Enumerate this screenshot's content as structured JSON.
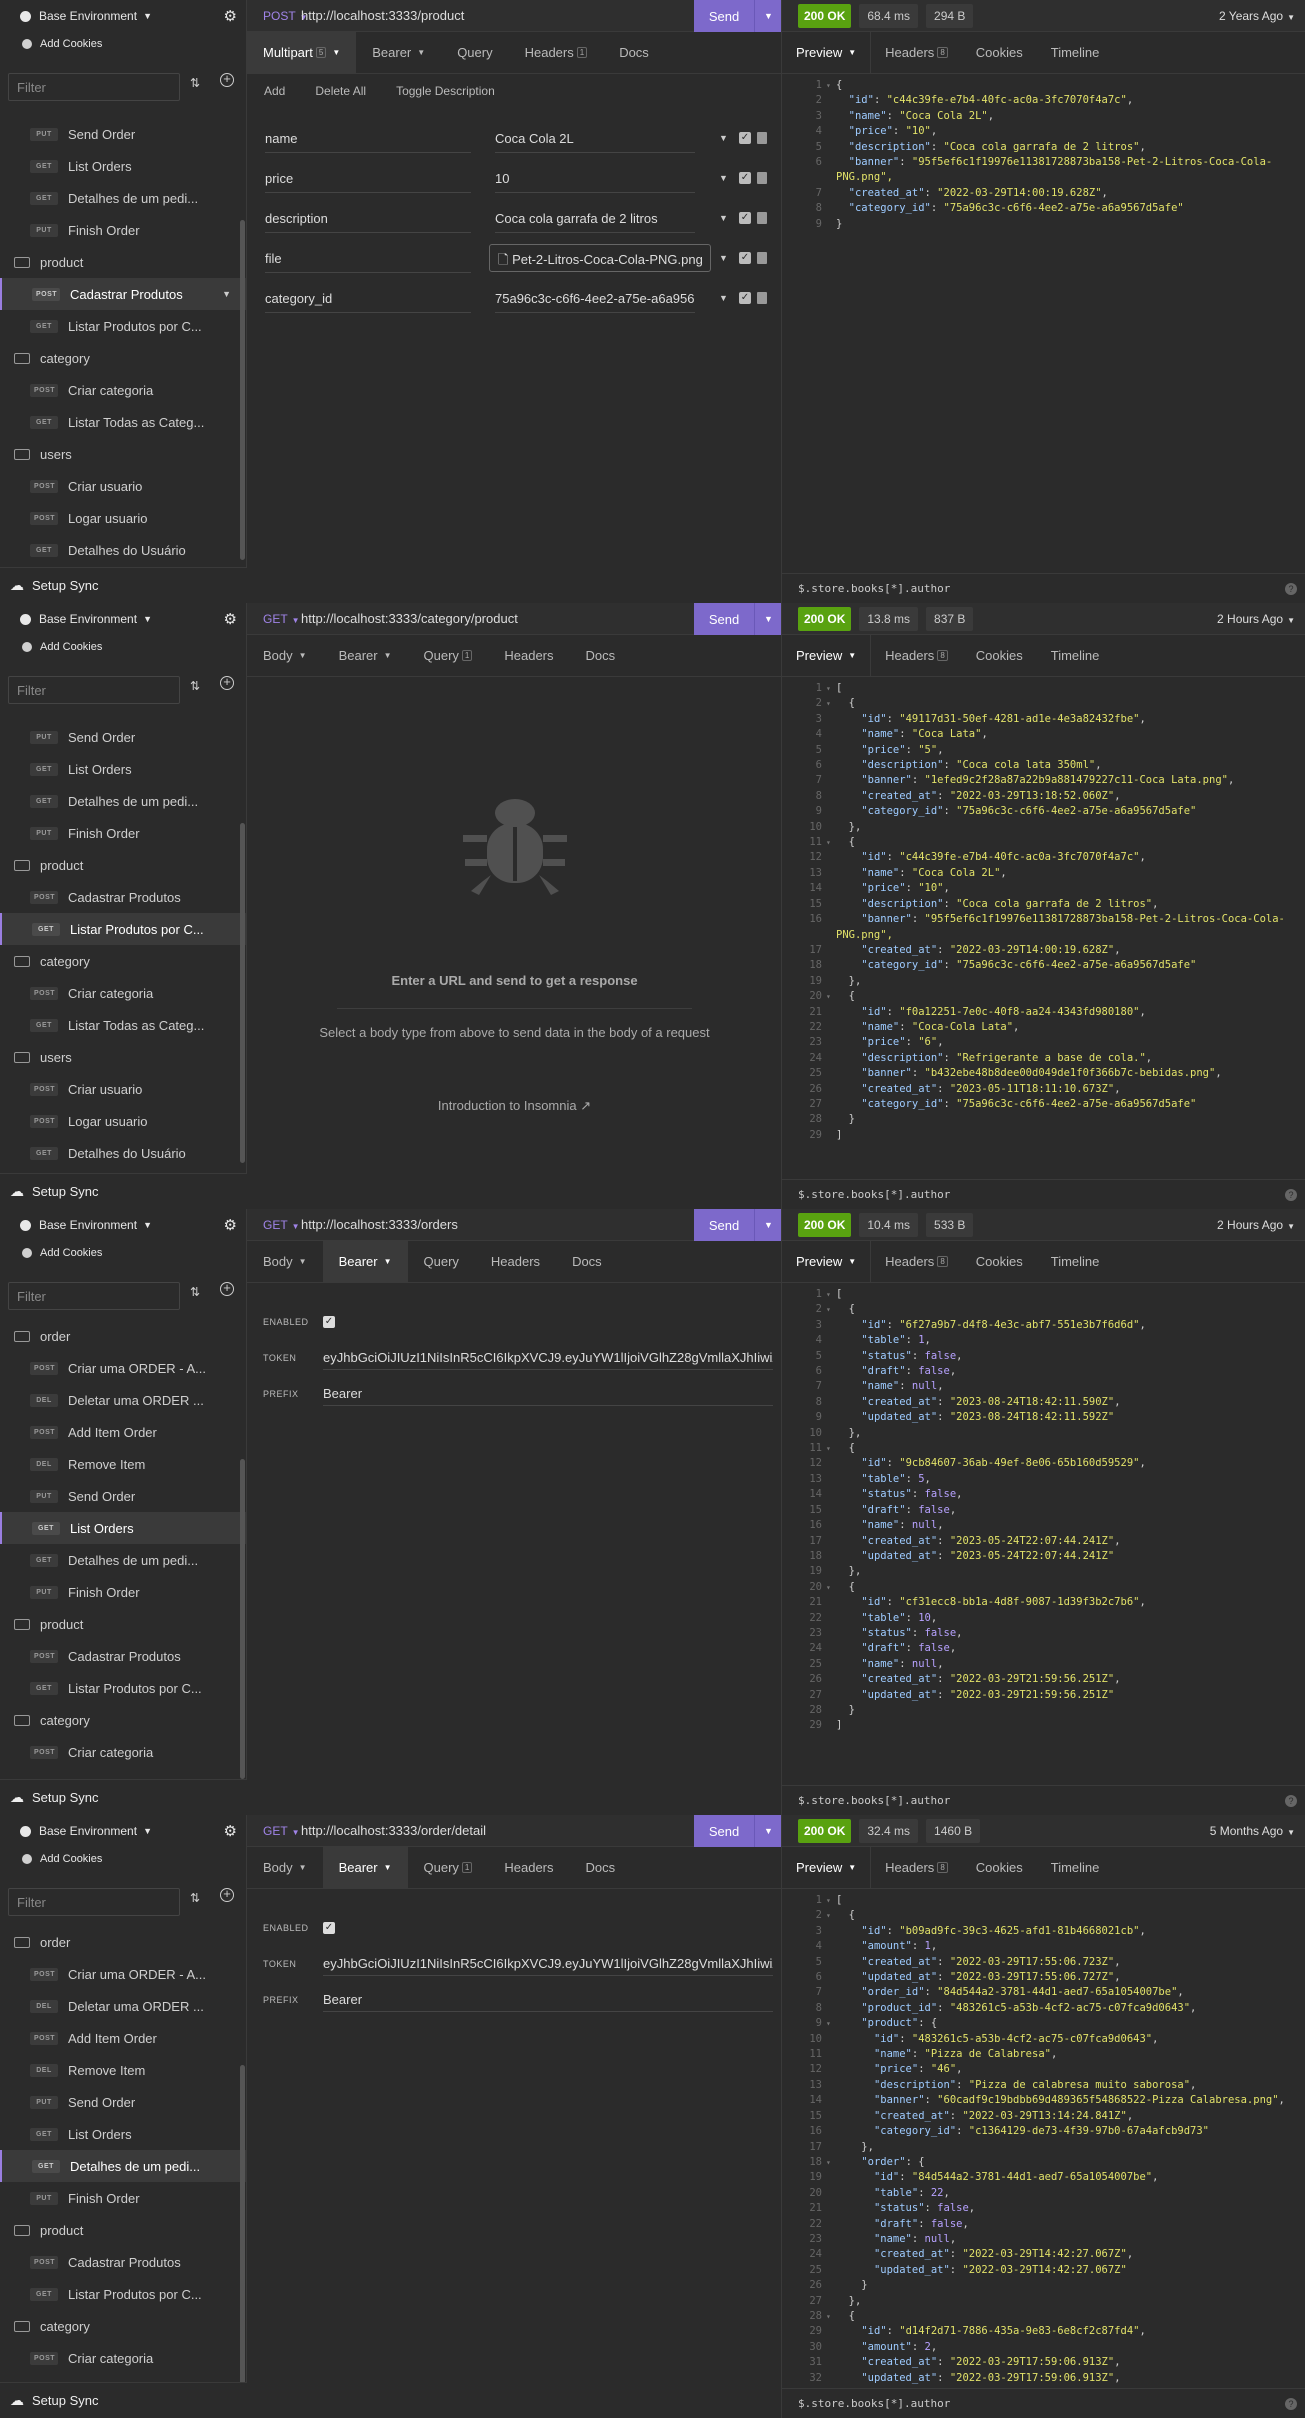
{
  "env": {
    "label": "Base Environment",
    "cookies": "Add Cookies",
    "filter_placeholder": "Filter",
    "sync": "Setup Sync"
  },
  "panels": [
    {
      "sidebar": [
        {
          "t": "item",
          "badge": "PUT",
          "label": "Send Order"
        },
        {
          "t": "item",
          "badge": "GET",
          "label": "List Orders"
        },
        {
          "t": "item",
          "badge": "GET",
          "label": "Detalhes de um pedi..."
        },
        {
          "t": "item",
          "badge": "PUT",
          "label": "Finish Order"
        },
        {
          "t": "folder",
          "label": "product"
        },
        {
          "t": "item",
          "badge": "POST",
          "label": "Cadastrar Produtos",
          "sel": true
        },
        {
          "t": "item",
          "badge": "GET",
          "label": "Listar Produtos por C..."
        },
        {
          "t": "folder",
          "label": "category"
        },
        {
          "t": "item",
          "badge": "POST",
          "label": "Criar categoria"
        },
        {
          "t": "item",
          "badge": "GET",
          "label": "Listar Todas as Categ..."
        },
        {
          "t": "folder",
          "label": "users"
        },
        {
          "t": "item",
          "badge": "POST",
          "label": "Criar usuario"
        },
        {
          "t": "item",
          "badge": "POST",
          "label": "Logar usuario"
        },
        {
          "t": "item",
          "badge": "GET",
          "label": "Detalhes do Usuário"
        }
      ],
      "method": "POST",
      "url": "http://localhost:3333/product",
      "send": "Send",
      "tabs": [
        {
          "label": "Multipart",
          "count": "5",
          "active": true,
          "caret": true
        },
        {
          "label": "Bearer",
          "caret": true
        },
        {
          "label": "Query"
        },
        {
          "label": "Headers",
          "count": "1"
        },
        {
          "label": "Docs"
        }
      ],
      "subbar": [
        "Add",
        "Delete All",
        "Toggle Description"
      ],
      "fields": [
        {
          "k": "name",
          "v": "Coca Cola 2L"
        },
        {
          "k": "price",
          "v": "10"
        },
        {
          "k": "description",
          "v": "Coca cola garrafa de 2 litros"
        },
        {
          "k": "file",
          "v": "Pet-2-Litros-Coca-Cola-PNG.png",
          "file": true
        },
        {
          "k": "category_id",
          "v": "75a96c3c-c6f6-4ee2-a75e-a6a9567"
        }
      ],
      "status": "200 OK",
      "time": "68.4 ms",
      "size": "294 B",
      "ago": "2 Years Ago",
      "rtabs": [
        {
          "label": "Preview",
          "active": true,
          "caret": true
        },
        {
          "label": "Headers",
          "count": "8"
        },
        {
          "label": "Cookies"
        },
        {
          "label": "Timeline"
        }
      ],
      "code": [
        "{",
        "  \"id\": \"c44c39fe-e7b4-40fc-ac0a-3fc7070f4a7c\",",
        "  \"name\": \"Coca Cola 2L\",",
        "  \"price\": \"10\",",
        "  \"description\": \"Coca cola garrafa de 2 litros\",",
        "  \"banner\": \"95f5ef6c1f19976e11381728873ba158-Pet-2-Litros-Coca-Cola-|PNG.png\",",
        "  \"created_at\": \"2022-03-29T14:00:19.628Z\",",
        "  \"category_id\": \"75a96c3c-c6f6-4ee2-a75e-a6a9567d5afe\"",
        "}"
      ],
      "query": "$.store.books[*].author"
    },
    {
      "sidebar": [
        {
          "t": "item",
          "badge": "PUT",
          "label": "Send Order"
        },
        {
          "t": "item",
          "badge": "GET",
          "label": "List Orders"
        },
        {
          "t": "item",
          "badge": "GET",
          "label": "Detalhes de um pedi..."
        },
        {
          "t": "item",
          "badge": "PUT",
          "label": "Finish Order"
        },
        {
          "t": "folder",
          "label": "product"
        },
        {
          "t": "item",
          "badge": "POST",
          "label": "Cadastrar Produtos"
        },
        {
          "t": "item",
          "badge": "GET",
          "label": "Listar Produtos por C...",
          "sel": true
        },
        {
          "t": "folder",
          "label": "category"
        },
        {
          "t": "item",
          "badge": "POST",
          "label": "Criar categoria"
        },
        {
          "t": "item",
          "badge": "GET",
          "label": "Listar Todas as Categ..."
        },
        {
          "t": "folder",
          "label": "users"
        },
        {
          "t": "item",
          "badge": "POST",
          "label": "Criar usuario"
        },
        {
          "t": "item",
          "badge": "POST",
          "label": "Logar usuario"
        },
        {
          "t": "item",
          "badge": "GET",
          "label": "Detalhes do Usuário"
        }
      ],
      "method": "GET",
      "url": "http://localhost:3333/category/product",
      "send": "Send",
      "tabs": [
        {
          "label": "Body",
          "caret": true
        },
        {
          "label": "Bearer",
          "caret": true
        },
        {
          "label": "Query",
          "count": "1"
        },
        {
          "label": "Headers"
        },
        {
          "label": "Docs"
        }
      ],
      "empty": {
        "title": "Enter a URL and send to get a response",
        "sub": "Select a body type from above to send data in the body of a request",
        "link": "Introduction to Insomnia"
      },
      "status": "200 OK",
      "time": "13.8 ms",
      "size": "837 B",
      "ago": "2 Hours Ago",
      "rtabs": [
        {
          "label": "Preview",
          "active": true,
          "caret": true
        },
        {
          "label": "Headers",
          "count": "8"
        },
        {
          "label": "Cookies"
        },
        {
          "label": "Timeline"
        }
      ],
      "code": [
        "[",
        "  {",
        "    \"id\": \"49117d31-50ef-4281-ad1e-4e3a82432fbe\",",
        "    \"name\": \"Coca Lata\",",
        "    \"price\": \"5\",",
        "    \"description\": \"Coca cola lata 350ml\",",
        "    \"banner\": \"1efed9c2f28a87a22b9a881479227c11-Coca Lata.png\",",
        "    \"created_at\": \"2022-03-29T13:18:52.060Z\",",
        "    \"category_id\": \"75a96c3c-c6f6-4ee2-a75e-a6a9567d5afe\"",
        "  },",
        "  {",
        "    \"id\": \"c44c39fe-e7b4-40fc-ac0a-3fc7070f4a7c\",",
        "    \"name\": \"Coca Cola 2L\",",
        "    \"price\": \"10\",",
        "    \"description\": \"Coca cola garrafa de 2 litros\",",
        "    \"banner\": \"95f5ef6c1f19976e11381728873ba158-Pet-2-Litros-Coca-Cola-|PNG.png\",",
        "    \"created_at\": \"2022-03-29T14:00:19.628Z\",",
        "    \"category_id\": \"75a96c3c-c6f6-4ee2-a75e-a6a9567d5afe\"",
        "  },",
        "  {",
        "    \"id\": \"f0a12251-7e0c-40f8-aa24-4343fd980180\",",
        "    \"name\": \"Coca-Cola Lata\",",
        "    \"price\": \"6\",",
        "    \"description\": \"Refrigerante a base de cola.\",",
        "    \"banner\": \"b432ebe48b8dee00d049de1f0f366b7c-bebidas.png\",",
        "    \"created_at\": \"2023-05-11T18:11:10.673Z\",",
        "    \"category_id\": \"75a96c3c-c6f6-4ee2-a75e-a6a9567d5afe\"",
        "  }",
        "]"
      ],
      "query": "$.store.books[*].author"
    },
    {
      "sidebar": [
        {
          "t": "folder",
          "label": "order"
        },
        {
          "t": "item",
          "badge": "POST",
          "label": "Criar uma ORDER - A..."
        },
        {
          "t": "item",
          "badge": "DEL",
          "label": "Deletar uma ORDER ..."
        },
        {
          "t": "item",
          "badge": "POST",
          "label": "Add Item Order"
        },
        {
          "t": "item",
          "badge": "DEL",
          "label": "Remove Item"
        },
        {
          "t": "item",
          "badge": "PUT",
          "label": "Send Order"
        },
        {
          "t": "item",
          "badge": "GET",
          "label": "List Orders",
          "sel": true
        },
        {
          "t": "item",
          "badge": "GET",
          "label": "Detalhes de um pedi..."
        },
        {
          "t": "item",
          "badge": "PUT",
          "label": "Finish Order"
        },
        {
          "t": "folder",
          "label": "product"
        },
        {
          "t": "item",
          "badge": "POST",
          "label": "Cadastrar Produtos"
        },
        {
          "t": "item",
          "badge": "GET",
          "label": "Listar Produtos por C..."
        },
        {
          "t": "folder",
          "label": "category"
        },
        {
          "t": "item",
          "badge": "POST",
          "label": "Criar categoria"
        }
      ],
      "method": "GET",
      "url": "http://localhost:3333/orders",
      "send": "Send",
      "tabs": [
        {
          "label": "Body",
          "caret": true
        },
        {
          "label": "Bearer",
          "caret": true,
          "active": true
        },
        {
          "label": "Query"
        },
        {
          "label": "Headers"
        },
        {
          "label": "Docs"
        }
      ],
      "auth": {
        "enabled": "ENABLED",
        "token_label": "TOKEN",
        "token": "eyJhbGciOiJIUzI1NiIsInR5cCI6IkpXVCJ9.eyJuYW1lIjoiVGlhZ28gVmllaXJhIiwiZW",
        "prefix_label": "PREFIX",
        "prefix": "Bearer"
      },
      "status": "200 OK",
      "time": "10.4 ms",
      "size": "533 B",
      "ago": "2 Hours Ago",
      "rtabs": [
        {
          "label": "Preview",
          "active": true,
          "caret": true
        },
        {
          "label": "Headers",
          "count": "8"
        },
        {
          "label": "Cookies"
        },
        {
          "label": "Timeline"
        }
      ],
      "code": [
        "[",
        "  {",
        "    \"id\": \"6f27a9b7-d4f8-4e3c-abf7-551e3b7f6d6d\",",
        "    \"table\": 1,",
        "    \"status\": false,",
        "    \"draft\": false,",
        "    \"name\": null,",
        "    \"created_at\": \"2023-08-24T18:42:11.590Z\",",
        "    \"updated_at\": \"2023-08-24T18:42:11.592Z\"",
        "  },",
        "  {",
        "    \"id\": \"9cb84607-36ab-49ef-8e06-65b160d59529\",",
        "    \"table\": 5,",
        "    \"status\": false,",
        "    \"draft\": false,",
        "    \"name\": null,",
        "    \"created_at\": \"2023-05-24T22:07:44.241Z\",",
        "    \"updated_at\": \"2023-05-24T22:07:44.241Z\"",
        "  },",
        "  {",
        "    \"id\": \"cf31ecc8-bb1a-4d8f-9087-1d39f3b2c7b6\",",
        "    \"table\": 10,",
        "    \"status\": false,",
        "    \"draft\": false,",
        "    \"name\": null,",
        "    \"created_at\": \"2022-03-29T21:59:56.251Z\",",
        "    \"updated_at\": \"2022-03-29T21:59:56.251Z\"",
        "  }",
        "]"
      ],
      "query": "$.store.books[*].author"
    },
    {
      "sidebar": [
        {
          "t": "folder",
          "label": "order"
        },
        {
          "t": "item",
          "badge": "POST",
          "label": "Criar uma ORDER - A..."
        },
        {
          "t": "item",
          "badge": "DEL",
          "label": "Deletar uma ORDER ..."
        },
        {
          "t": "item",
          "badge": "POST",
          "label": "Add Item Order"
        },
        {
          "t": "item",
          "badge": "DEL",
          "label": "Remove Item"
        },
        {
          "t": "item",
          "badge": "PUT",
          "label": "Send Order"
        },
        {
          "t": "item",
          "badge": "GET",
          "label": "List Orders"
        },
        {
          "t": "item",
          "badge": "GET",
          "label": "Detalhes de um pedi...",
          "sel": true
        },
        {
          "t": "item",
          "badge": "PUT",
          "label": "Finish Order"
        },
        {
          "t": "folder",
          "label": "product"
        },
        {
          "t": "item",
          "badge": "POST",
          "label": "Cadastrar Produtos"
        },
        {
          "t": "item",
          "badge": "GET",
          "label": "Listar Produtos por C..."
        },
        {
          "t": "folder",
          "label": "category"
        },
        {
          "t": "item",
          "badge": "POST",
          "label": "Criar categoria"
        }
      ],
      "method": "GET",
      "url": "http://localhost:3333/order/detail",
      "send": "Send",
      "tabs": [
        {
          "label": "Body",
          "caret": true
        },
        {
          "label": "Bearer",
          "caret": true,
          "active": true
        },
        {
          "label": "Query",
          "count": "1"
        },
        {
          "label": "Headers"
        },
        {
          "label": "Docs"
        }
      ],
      "auth": {
        "enabled": "ENABLED",
        "token_label": "TOKEN",
        "token": "eyJhbGciOiJIUzI1NiIsInR5cCI6IkpXVCJ9.eyJuYW1lIjoiVGlhZ28gVmllaXJhIiwiZW",
        "prefix_label": "PREFIX",
        "prefix": "Bearer"
      },
      "status": "200 OK",
      "time": "32.4 ms",
      "size": "1460 B",
      "ago": "5 Months Ago",
      "rtabs": [
        {
          "label": "Preview",
          "active": true,
          "caret": true
        },
        {
          "label": "Headers",
          "count": "8"
        },
        {
          "label": "Cookies"
        },
        {
          "label": "Timeline"
        }
      ],
      "code": [
        "[",
        "  {",
        "    \"id\": \"b09ad9fc-39c3-4625-afd1-81b4668021cb\",",
        "    \"amount\": 1,",
        "    \"created_at\": \"2022-03-29T17:55:06.723Z\",",
        "    \"updated_at\": \"2022-03-29T17:55:06.727Z\",",
        "    \"order_id\": \"84d544a2-3781-44d1-aed7-65a1054007be\",",
        "    \"product_id\": \"483261c5-a53b-4cf2-ac75-c07fca9d0643\",",
        "    \"product\": {",
        "      \"id\": \"483261c5-a53b-4cf2-ac75-c07fca9d0643\",",
        "      \"name\": \"Pizza de Calabresa\",",
        "      \"price\": \"46\",",
        "      \"description\": \"Pizza de calabresa muito saborosa\",",
        "      \"banner\": \"60cadf9c19bdbb69d489365f54868522-Pizza Calabresa.png\",",
        "      \"created_at\": \"2022-03-29T13:14:24.841Z\",",
        "      \"category_id\": \"c1364129-de73-4f39-97b0-67a4afcb9d73\"",
        "    },",
        "    \"order\": {",
        "      \"id\": \"84d544a2-3781-44d1-aed7-65a1054007be\",",
        "      \"table\": 22,",
        "      \"status\": false,",
        "      \"draft\": false,",
        "      \"name\": null,",
        "      \"created_at\": \"2022-03-29T14:42:27.067Z\",",
        "      \"updated_at\": \"2022-03-29T14:42:27.067Z\"",
        "    }",
        "  },",
        "  {",
        "    \"id\": \"d14f2d71-7886-435a-9e83-6e8cf2c87fd4\",",
        "    \"amount\": 2,",
        "    \"created_at\": \"2022-03-29T17:59:06.913Z\",",
        "    \"updated_at\": \"2022-03-29T17:59:06.913Z\","
      ],
      "query": "$.store.books[*].author"
    }
  ]
}
